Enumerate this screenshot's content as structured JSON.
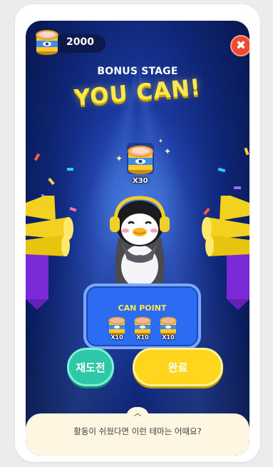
{
  "header": {
    "coin_count": "2000",
    "close_icon": "close-icon"
  },
  "stage": {
    "label": "BONUS STAGE",
    "headline": "YOU CAN!"
  },
  "reward": {
    "icon": "tuna-can-icon",
    "count": "X30"
  },
  "can_point": {
    "title": "CAN POINT",
    "items": [
      {
        "icon": "tuna-can-icon",
        "label": "X10"
      },
      {
        "icon": "tuna-can-icon",
        "label": "X10"
      },
      {
        "icon": "tuna-can-icon",
        "label": "X10"
      }
    ]
  },
  "actions": {
    "retry_label": "재도전",
    "done_label": "완료"
  },
  "suggestion": {
    "chevron_icon": "chevron-up-icon",
    "text": "활동이 쉬웠다면 이런 테마는 어때요?"
  },
  "colors": {
    "background": "#0f2676",
    "accent_yellow": "#ffe84a",
    "retry_button": "#2dc7a9",
    "done_button": "#ffd51e",
    "close_button": "#f0492f",
    "panel": "#2c6cf2"
  }
}
